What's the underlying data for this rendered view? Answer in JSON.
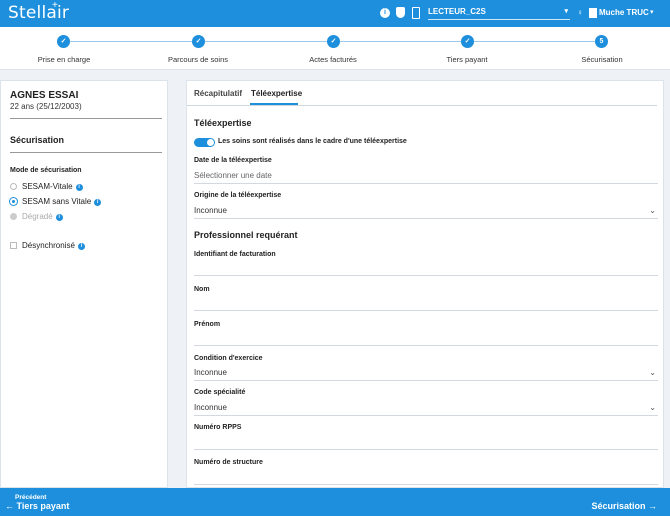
{
  "header": {
    "logo": "Stellair",
    "logo_plus": "+",
    "info_icon": "i",
    "reader": "LECTEUR_C2S",
    "chat_icon": "♀",
    "user": "Muche TRUC",
    "chevron": "▾"
  },
  "stepper": {
    "steps": [
      {
        "label": "Prise en charge",
        "marker": "✓"
      },
      {
        "label": "Parcours de soins",
        "marker": "✓"
      },
      {
        "label": "Actes facturés",
        "marker": "✓"
      },
      {
        "label": "Tiers payant",
        "marker": "✓"
      },
      {
        "label": "Sécurisation",
        "marker": "5"
      }
    ]
  },
  "patient": {
    "name": "AGNES ESSAI",
    "age": "22 ans (25/12/2003)"
  },
  "left": {
    "section_title": "Sécurisation",
    "mode_title": "Mode de sécurisation",
    "modes": [
      {
        "label": "SESAM-Vitale",
        "state": "unchecked"
      },
      {
        "label": "SESAM sans Vitale",
        "state": "checked"
      },
      {
        "label": "Dégradé",
        "state": "disabled"
      }
    ],
    "desync_label": "Désynchronisé",
    "info": "i"
  },
  "tabs": [
    {
      "label": "Récapitulatif"
    },
    {
      "label": "Téléexpertise",
      "active": true
    }
  ],
  "form": {
    "section1": "Téléexpertise",
    "toggle_label": "Les soins sont réalisés dans le cadre d'une téléexpertise",
    "toggle_on": true,
    "date_label": "Date de la téléexpertise",
    "date_placeholder": "Sélectionner une date",
    "origin_label": "Origine de la téléexpertise",
    "origin_value": "Inconnue",
    "section2": "Professionnel requérant",
    "billing_id_label": "Identifiant de facturation",
    "nom_label": "Nom",
    "prenom_label": "Prénom",
    "condition_label": "Condition d'exercice",
    "condition_value": "Inconnue",
    "specialty_label": "Code spécialité",
    "specialty_value": "Inconnue",
    "rpps_label": "Numéro RPPS",
    "structure_label": "Numéro de structure",
    "dd_chevron": "⌄"
  },
  "footer": {
    "prev_small": "Précédent",
    "prev_main": "← Tiers payant",
    "next_main": "Sécurisation →"
  },
  "colors": {
    "primary": "#1d8fdc"
  }
}
